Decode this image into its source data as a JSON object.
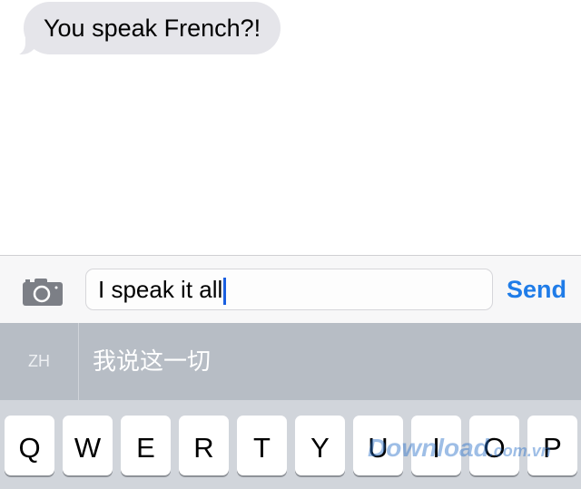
{
  "conversation": {
    "messages": [
      {
        "direction": "incoming",
        "text": "You speak French?!"
      }
    ]
  },
  "compose": {
    "camera_icon": "camera-icon",
    "input_value": "I speak it all",
    "send_label": "Send",
    "accent": "#1f7ce8"
  },
  "candidates": {
    "language": "ZH",
    "suggestion": "我说这一切"
  },
  "keyboard": {
    "row1": [
      "Q",
      "W",
      "E",
      "R",
      "T",
      "Y",
      "U",
      "I",
      "O",
      "P"
    ]
  },
  "watermark": {
    "text": "Download",
    ".suffix": ".com.vn"
  }
}
